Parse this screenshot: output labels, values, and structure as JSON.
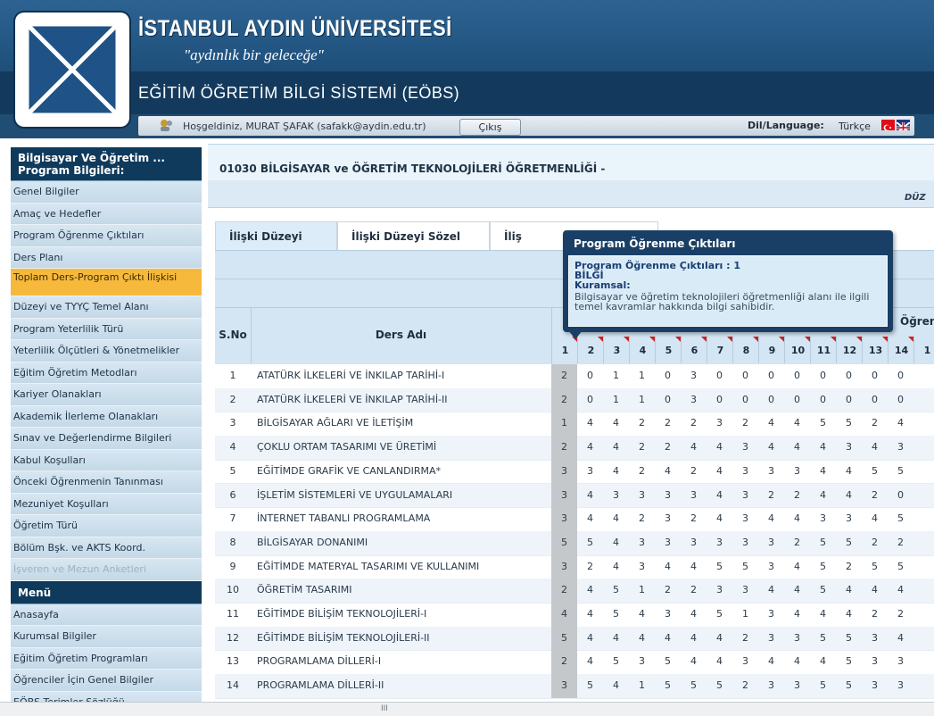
{
  "header": {
    "university": "İSTANBUL AYDIN ÜNİVERSİTESİ",
    "motto": "\"aydınlık bir geleceğe\"",
    "system_title": "EĞİTİM ÖĞRETİM BİLGİ SİSTEMİ (EÖBS)",
    "welcome": "Hoşgeldiniz, MURAT ŞAFAK (safakk@aydin.edu.tr)",
    "logout_label": "Çıkış",
    "language_label": "Dil/Language:",
    "language_value": "Türkçe"
  },
  "sidebar": {
    "program_heading": "Bilgisayar Ve Öğretim ... Program Bilgileri:",
    "program_items": [
      {
        "label": "Genel Bilgiler"
      },
      {
        "label": "Amaç ve Hedefler"
      },
      {
        "label": "Program Öğrenme Çıktıları"
      },
      {
        "label": "Ders Planı"
      },
      {
        "label": "Toplam Ders-Program Çıktı İlişkisi"
      },
      {
        "label": "Düzeyi ve TYYÇ Temel Alanı"
      },
      {
        "label": "Program Yeterlilik Türü"
      },
      {
        "label": "Yeterlilik Ölçütleri & Yönetmelikler"
      },
      {
        "label": "Eğitim Öğretim Metodları"
      },
      {
        "label": "Kariyer Olanakları"
      },
      {
        "label": "Akademik İlerleme Olanakları"
      },
      {
        "label": "Sınav ve Değerlendirme Bilgileri"
      },
      {
        "label": "Kabul Koşulları"
      },
      {
        "label": "Önceki Öğrenmenin Tanınması"
      },
      {
        "label": "Mezuniyet Koşulları"
      },
      {
        "label": "Öğretim Türü"
      },
      {
        "label": "Bölüm Bşk. ve AKTS Koord."
      },
      {
        "label": "İşveren ve Mezun Anketleri"
      }
    ],
    "menu_heading": "Menü",
    "menu_items": [
      {
        "label": "Anasayfa"
      },
      {
        "label": "Kurumsal Bilgiler"
      },
      {
        "label": "Eğitim Öğretim Programları"
      },
      {
        "label": "Öğrenciler İçin Genel Bilgiler"
      },
      {
        "label": "EÖBS Terimler Sözlüğü"
      }
    ]
  },
  "main": {
    "program_title": "01030 BİLGİSAYAR ve ÖĞRETİM TEKNOLOJİLERİ ÖĞRETMENLİĞİ -",
    "sub_text": "DÜZ",
    "tabs": [
      {
        "label": "İlişki Düzeyi Sayısal"
      },
      {
        "label": "İlişki Düzeyi Sözel"
      },
      {
        "label": "İliş"
      }
    ],
    "table": {
      "col_sno": "S.No",
      "col_course": "Ders Adı",
      "col_outcomes": "Öğrenm",
      "outcome_numbers": [
        "1",
        "2",
        "3",
        "4",
        "5",
        "6",
        "7",
        "8",
        "9",
        "10",
        "11",
        "12",
        "13",
        "14",
        "1"
      ],
      "rows": [
        {
          "sno": "1",
          "name": "ATATÜRK İLKELERİ VE İNKILAP TARİHİ-I",
          "vals": [
            "2",
            "0",
            "1",
            "1",
            "0",
            "3",
            "0",
            "0",
            "0",
            "0",
            "0",
            "0",
            "0",
            "0"
          ]
        },
        {
          "sno": "2",
          "name": "ATATÜRK İLKELERİ VE İNKILAP TARİHİ-II",
          "vals": [
            "2",
            "0",
            "1",
            "1",
            "0",
            "3",
            "0",
            "0",
            "0",
            "0",
            "0",
            "0",
            "0",
            "0"
          ]
        },
        {
          "sno": "3",
          "name": "BİLGİSAYAR AĞLARI VE İLETİŞİM",
          "vals": [
            "1",
            "4",
            "4",
            "2",
            "2",
            "2",
            "3",
            "2",
            "4",
            "4",
            "5",
            "5",
            "2",
            "4"
          ]
        },
        {
          "sno": "4",
          "name": "ÇOKLU ORTAM TASARIMI VE ÜRETİMİ",
          "vals": [
            "2",
            "4",
            "4",
            "2",
            "2",
            "4",
            "4",
            "3",
            "4",
            "4",
            "4",
            "3",
            "4",
            "3"
          ]
        },
        {
          "sno": "5",
          "name": "EĞİTİMDE GRAFİK VE CANLANDIRMA*",
          "vals": [
            "3",
            "3",
            "4",
            "2",
            "4",
            "2",
            "4",
            "3",
            "3",
            "3",
            "4",
            "4",
            "5",
            "5"
          ]
        },
        {
          "sno": "6",
          "name": "İŞLETİM SİSTEMLERİ VE UYGULAMALARI",
          "vals": [
            "3",
            "4",
            "3",
            "3",
            "3",
            "3",
            "4",
            "3",
            "2",
            "2",
            "4",
            "4",
            "2",
            "0"
          ]
        },
        {
          "sno": "7",
          "name": "İNTERNET TABANLI PROGRAMLAMA",
          "vals": [
            "3",
            "4",
            "4",
            "2",
            "3",
            "2",
            "4",
            "3",
            "4",
            "4",
            "3",
            "3",
            "4",
            "5"
          ]
        },
        {
          "sno": "8",
          "name": "BİLGİSAYAR DONANIMI",
          "vals": [
            "5",
            "5",
            "4",
            "3",
            "3",
            "3",
            "3",
            "3",
            "3",
            "2",
            "5",
            "5",
            "2",
            "2"
          ]
        },
        {
          "sno": "9",
          "name": "EĞİTİMDE MATERYAL TASARIMI VE KULLANIMI",
          "vals": [
            "3",
            "2",
            "4",
            "3",
            "4",
            "4",
            "5",
            "5",
            "3",
            "4",
            "5",
            "2",
            "5",
            "5"
          ]
        },
        {
          "sno": "10",
          "name": "ÖĞRETİM TASARIMI",
          "vals": [
            "2",
            "4",
            "5",
            "1",
            "2",
            "2",
            "3",
            "3",
            "4",
            "4",
            "5",
            "4",
            "4",
            "4"
          ]
        },
        {
          "sno": "11",
          "name": "EĞİTİMDE BİLİŞİM TEKNOLOJİLERİ-I",
          "vals": [
            "4",
            "4",
            "5",
            "4",
            "3",
            "4",
            "5",
            "1",
            "3",
            "4",
            "4",
            "4",
            "2",
            "2"
          ]
        },
        {
          "sno": "12",
          "name": "EĞİTİMDE BİLİŞİM TEKNOLOJİLERİ-II",
          "vals": [
            "5",
            "4",
            "4",
            "4",
            "4",
            "4",
            "4",
            "2",
            "3",
            "3",
            "5",
            "5",
            "3",
            "4"
          ]
        },
        {
          "sno": "13",
          "name": "PROGRAMLAMA DİLLERİ-I",
          "vals": [
            "2",
            "4",
            "5",
            "3",
            "5",
            "4",
            "4",
            "3",
            "4",
            "4",
            "4",
            "5",
            "3",
            "3"
          ]
        },
        {
          "sno": "14",
          "name": "PROGRAMLAMA DİLLERİ-II",
          "vals": [
            "3",
            "5",
            "4",
            "1",
            "5",
            "5",
            "5",
            "2",
            "3",
            "3",
            "5",
            "5",
            "3",
            "3"
          ]
        }
      ]
    }
  },
  "tooltip": {
    "title": "Program Öğrenme Çıktıları",
    "line1": "Program Öğrenme Çıktıları : 1",
    "line2": "BİLGİ",
    "line3": "Kuramsal:",
    "desc": "Bilgisayar ve öğretim teknolojileri öğretmenliği alanı ile ilgili temel kavramlar hakkında bilgi sahibidir."
  },
  "scrollbar": {
    "grip": "III"
  }
}
